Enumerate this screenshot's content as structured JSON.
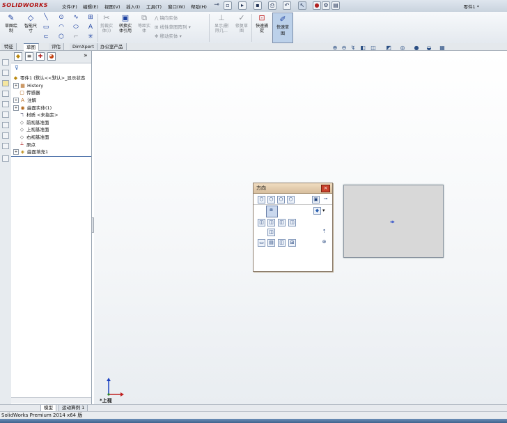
{
  "app": {
    "logo": "SOLIDWORKS",
    "doc_title": "零件1 *"
  },
  "menu": [
    "文件(F)",
    "编辑(E)",
    "视图(V)",
    "插入(I)",
    "工具(T)",
    "窗口(W)",
    "帮助(H)"
  ],
  "commands": {
    "sketch": "草图绘\n制",
    "smart_dim": "智能尺\n寸",
    "trim": "剪裁实\n体(I)",
    "convert": "转换实\n体引用",
    "offset": "等距实\n体",
    "mirror": "镜向实体",
    "linear_pattern": "线性草图阵列",
    "move": "移动实体",
    "show_hide": "显示/删\n除几...",
    "repair": "修复草\n图",
    "quick_snap": "快速捕\n捉",
    "rapid_sketch": "快速草\n图"
  },
  "tabs": [
    "特征",
    "草图",
    "评估",
    "DimXpert",
    "办公室产品"
  ],
  "active_tab": "草图",
  "feature_tree": {
    "root": "零件1 (默认<<默认>_显示状态",
    "items": [
      {
        "label": "History",
        "icon": "history-icon",
        "expandable": true
      },
      {
        "label": "传感器",
        "icon": "sensor-icon",
        "expandable": false
      },
      {
        "label": "注解",
        "icon": "annotation-icon",
        "expandable": true
      },
      {
        "label": "曲面实体(1)",
        "icon": "surface-body-icon",
        "expandable": true
      },
      {
        "label": "材质 <未指定>",
        "icon": "material-icon",
        "expandable": false
      },
      {
        "label": "前视基准面",
        "icon": "plane-icon",
        "expandable": false
      },
      {
        "label": "上视基准面",
        "icon": "plane-icon",
        "expandable": false
      },
      {
        "label": "右视基准面",
        "icon": "plane-icon",
        "expandable": false
      },
      {
        "label": "原点",
        "icon": "origin-icon",
        "expandable": false
      },
      {
        "label": "曲面填充1",
        "icon": "fill-surface-icon",
        "expandable": true
      }
    ]
  },
  "orientation_dialog": {
    "title": "方向",
    "close": "×"
  },
  "bottom_tabs": [
    "模型",
    "运动算例 1"
  ],
  "view_label": "*上视",
  "status": "SolidWorks Premium 2014 x64 版",
  "colors": {
    "accent": "#c8402a",
    "selection": "#cad8ee",
    "tree_line": "#4a6fa8"
  }
}
